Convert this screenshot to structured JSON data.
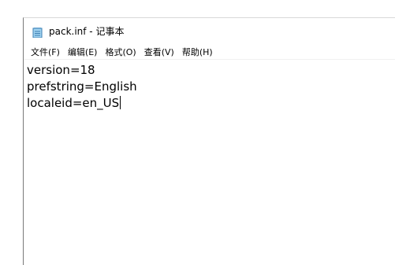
{
  "window": {
    "title": "pack.inf - 记事本",
    "icon": "notepad-icon"
  },
  "menubar": {
    "items": [
      {
        "label": "文件(F)"
      },
      {
        "label": "编辑(E)"
      },
      {
        "label": "格式(O)"
      },
      {
        "label": "查看(V)"
      },
      {
        "label": "帮助(H)"
      }
    ]
  },
  "editor": {
    "lines": [
      "version=18",
      "prefstring=English",
      "localeid=en_US"
    ]
  }
}
